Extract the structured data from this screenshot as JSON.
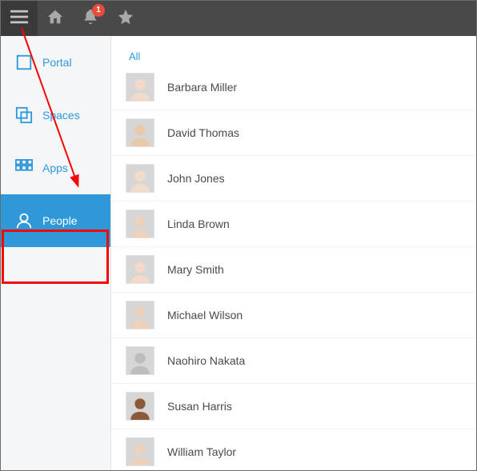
{
  "topbar": {
    "notification_count": "1"
  },
  "sidebar": {
    "items": [
      {
        "label": "Portal"
      },
      {
        "label": "Spaces"
      },
      {
        "label": "Apps"
      },
      {
        "label": "People"
      }
    ]
  },
  "main": {
    "filter_label": "All",
    "people": [
      {
        "name": "Barbara Miller"
      },
      {
        "name": "David Thomas"
      },
      {
        "name": "John Jones"
      },
      {
        "name": "Linda Brown"
      },
      {
        "name": "Mary Smith"
      },
      {
        "name": "Michael Wilson"
      },
      {
        "name": "Naohiro Nakata"
      },
      {
        "name": "Susan Harris"
      },
      {
        "name": "William Taylor"
      }
    ]
  }
}
